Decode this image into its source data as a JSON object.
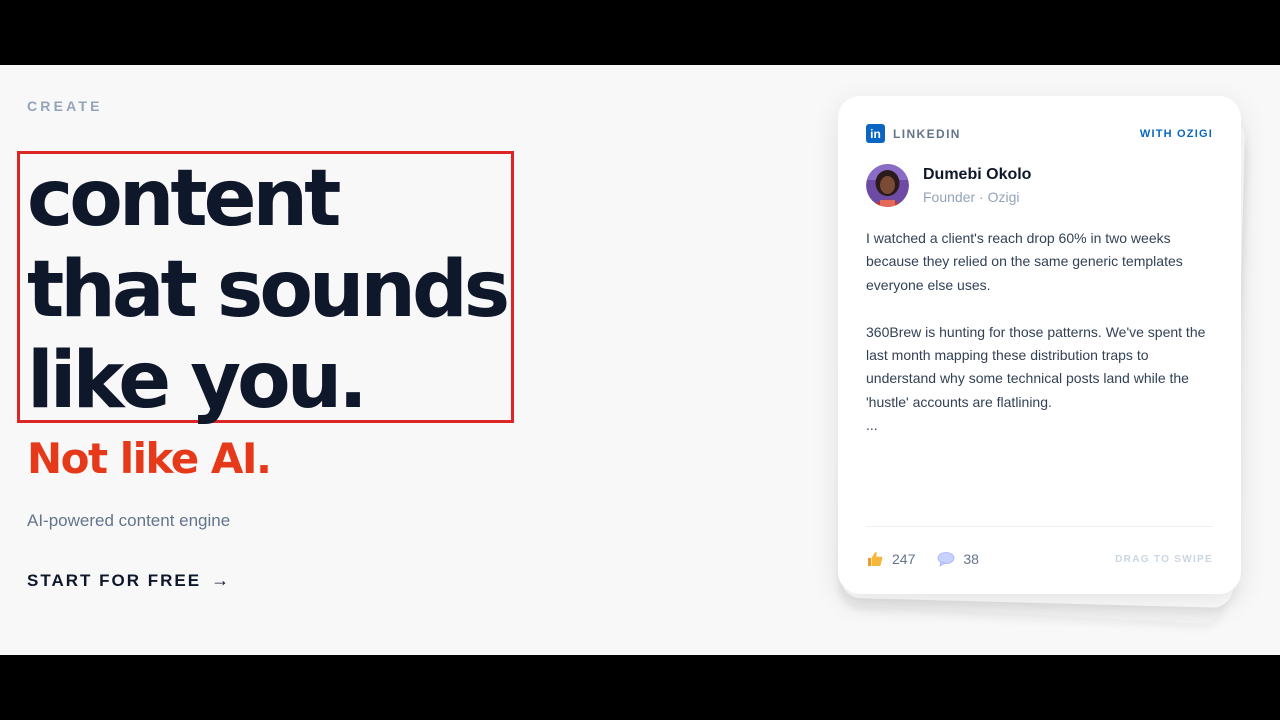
{
  "hero": {
    "eyebrow": "CREATE",
    "headline": "content that sounds like you.",
    "accent": "Not like AI.",
    "subtitle": "AI-powered content engine",
    "cta_label": "START FOR FREE",
    "cta_arrow": "→"
  },
  "card": {
    "platform_label": "LINKEDIN",
    "platform_logo": "in",
    "with_label": "WITH OZIGI",
    "author_name": "Dumebi Okolo",
    "author_role": "Founder · Ozigi",
    "paragraph_1": "I watched a client's reach drop 60% in two weeks because they relied on the same generic templates everyone else uses.",
    "paragraph_2": "360Brew is hunting for those patterns. We've spent the last month mapping these distribution traps to understand why some technical posts land while the 'hustle' accounts are flatlining.",
    "ellipsis": "...",
    "likes": "247",
    "comments": "38",
    "swipe_hint": "DRAG TO SWIPE"
  },
  "colors": {
    "headline": "#0f172a",
    "accent": "#e5391a",
    "linkedin": "#0a66c2",
    "highlight_box": "#dc2626"
  },
  "icons": {
    "platform": "linkedin-icon",
    "likes": "thumbs-up-icon",
    "comments": "speech-bubble-icon",
    "cta": "arrow-right-icon"
  }
}
